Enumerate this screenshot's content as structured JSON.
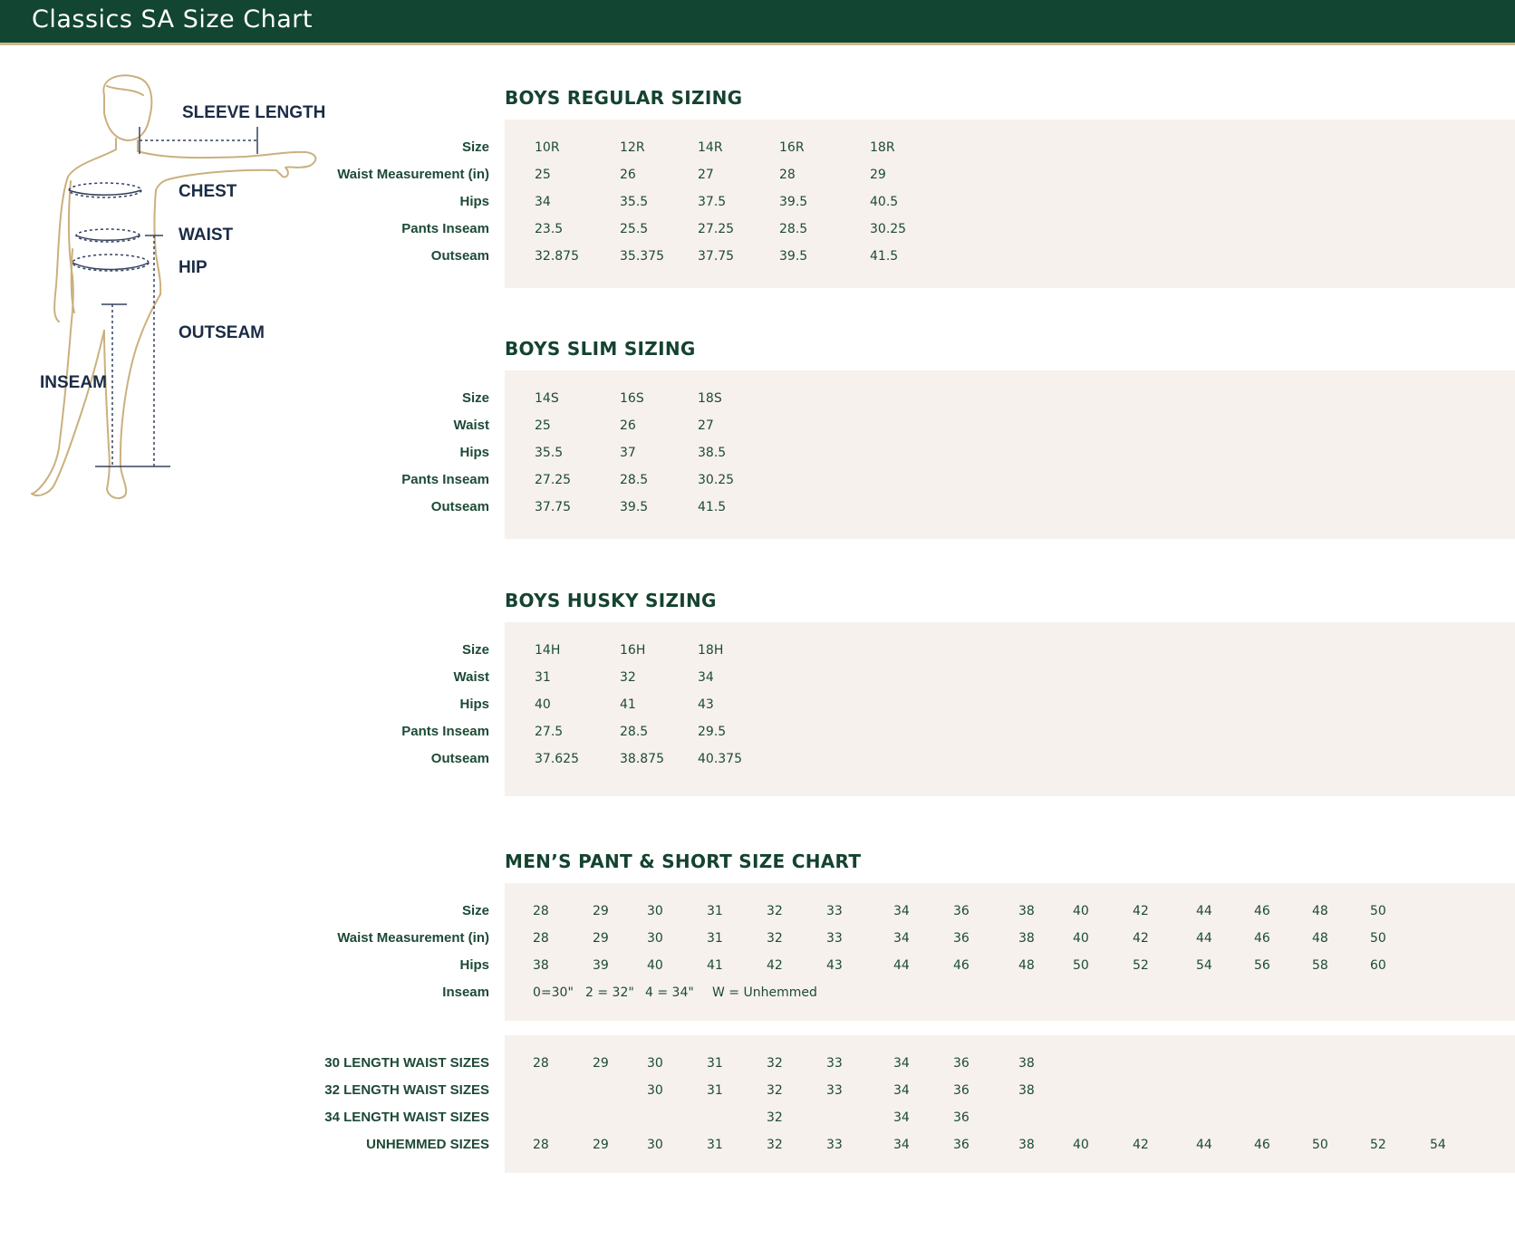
{
  "header": {
    "title": "Classics SA Size Chart"
  },
  "figure_labels": {
    "sleeve": "SLEEVE LENGTH",
    "chest": "CHEST",
    "waist": "WAIST",
    "hip": "HIP",
    "outseam": "OUTSEAM",
    "inseam": "INSEAM"
  },
  "boys_regular": {
    "title": "BOYS REGULAR SIZING",
    "rows": [
      {
        "label": "Size",
        "values": [
          "10R",
          "12R",
          "14R",
          "16R",
          "18R"
        ]
      },
      {
        "label": "Waist Measurement (in)",
        "values": [
          "25",
          "26",
          "27",
          "28",
          "29"
        ]
      },
      {
        "label": "Hips",
        "values": [
          "34",
          "35.5",
          "37.5",
          "39.5",
          "40.5"
        ]
      },
      {
        "label": "Pants Inseam",
        "values": [
          "23.5",
          "25.5",
          "27.25",
          "28.5",
          "30.25"
        ]
      },
      {
        "label": "Outseam",
        "values": [
          "32.875",
          "35.375",
          "37.75",
          "39.5",
          "41.5"
        ]
      }
    ]
  },
  "boys_slim": {
    "title": "BOYS SLIM SIZING",
    "rows": [
      {
        "label": "Size",
        "values": [
          "14S",
          "16S",
          "18S"
        ]
      },
      {
        "label": "Waist",
        "values": [
          "25",
          "26",
          "27"
        ]
      },
      {
        "label": "Hips",
        "values": [
          "35.5",
          "37",
          "38.5"
        ]
      },
      {
        "label": "Pants Inseam",
        "values": [
          "27.25",
          "28.5",
          "30.25"
        ]
      },
      {
        "label": "Outseam",
        "values": [
          "37.75",
          "39.5",
          "41.5"
        ]
      }
    ]
  },
  "boys_husky": {
    "title": "BOYS HUSKY SIZING",
    "rows": [
      {
        "label": "Size",
        "values": [
          "14H",
          "16H",
          "18H"
        ]
      },
      {
        "label": "Waist",
        "values": [
          "31",
          "32",
          "34"
        ]
      },
      {
        "label": "Hips",
        "values": [
          "40",
          "41",
          "43"
        ]
      },
      {
        "label": "Pants Inseam",
        "values": [
          "27.5",
          "28.5",
          "29.5"
        ]
      },
      {
        "label": "Outseam",
        "values": [
          "37.625",
          "38.875",
          "40.375"
        ]
      }
    ]
  },
  "mens": {
    "title": "MEN’S PANT & SHORT SIZE CHART",
    "rows": [
      {
        "label": "Size",
        "values": [
          "28",
          "29",
          "30",
          "31",
          "32",
          "33",
          "34",
          "36",
          "38",
          "40",
          "42",
          "44",
          "46",
          "48",
          "50"
        ]
      },
      {
        "label": "Waist Measurement (in)",
        "values": [
          "28",
          "29",
          "30",
          "31",
          "32",
          "33",
          "34",
          "36",
          "38",
          "40",
          "42",
          "44",
          "46",
          "48",
          "50"
        ]
      },
      {
        "label": "Hips",
        "values": [
          "38",
          "39",
          "40",
          "41",
          "42",
          "43",
          "44",
          "46",
          "48",
          "50",
          "52",
          "54",
          "56",
          "58",
          "60"
        ]
      }
    ],
    "inseam": {
      "label": "Inseam",
      "values": [
        "0=30\"",
        "2 = 32\"",
        "4 = 34\"",
        "W = Unhemmed"
      ]
    }
  },
  "mens_lengths": {
    "rows": [
      {
        "label": "30 LENGTH WAIST SIZES",
        "values": [
          "28",
          "29",
          "30",
          "31",
          "32",
          "33",
          "34",
          "36",
          "38",
          "",
          "",
          "",
          "",
          "",
          ""
        ]
      },
      {
        "label": "32 LENGTH WAIST SIZES",
        "values": [
          "",
          "",
          "30",
          "31",
          "32",
          "33",
          "34",
          "36",
          "38",
          "",
          "",
          "",
          "",
          "",
          ""
        ]
      },
      {
        "label": "34 LENGTH WAIST SIZES",
        "values": [
          "",
          "",
          "",
          "",
          "32",
          "",
          "34",
          "36",
          "",
          "",
          "",
          "",
          "",
          "",
          ""
        ]
      },
      {
        "label": "UNHEMMED SIZES",
        "values": [
          "28",
          "29",
          "30",
          "31",
          "32",
          "33",
          "34",
          "36",
          "38",
          "40",
          "42",
          "44",
          "46",
          "50",
          "52",
          "54"
        ]
      }
    ]
  }
}
